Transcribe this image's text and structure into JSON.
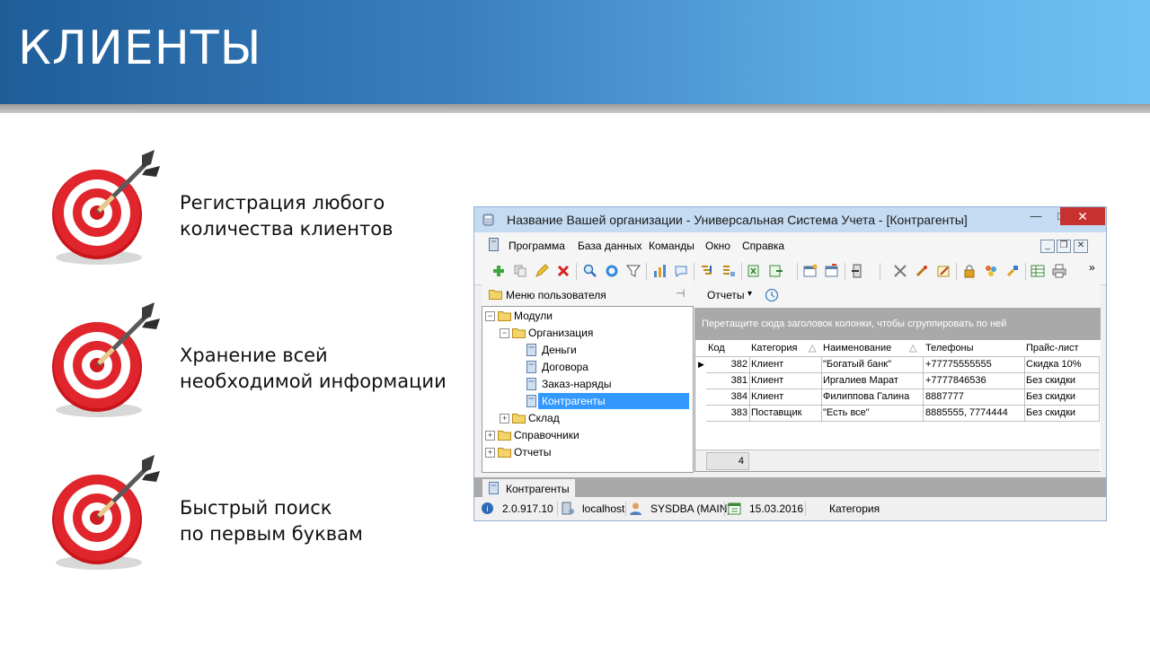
{
  "slide": {
    "title": "КЛИЕНТЫ",
    "bullets": [
      {
        "line1": "Регистрация любого",
        "line2": "количества клиентов"
      },
      {
        "line1": "Хранение всей",
        "line2": "необходимой информации"
      },
      {
        "line1": "Быстрый поиск",
        "line2": "по первым буквам"
      }
    ]
  },
  "window": {
    "title": "Название Вашей организации - Универсальная Система Учета - [Контрагенты]",
    "controls": {
      "minimize": "—",
      "maximize": "□",
      "close": "✕"
    },
    "menu": [
      "Программа",
      "База данных",
      "Команды",
      "Окно",
      "Справка"
    ],
    "mdi": {
      "minimize": "_",
      "restore": "❐",
      "close": "✕"
    },
    "more": "»",
    "left_panel": {
      "header": "Меню пользователя",
      "pin": "⊣",
      "tree": [
        {
          "label": "Модули",
          "expander": "−",
          "kind": "folder"
        },
        {
          "label": "Организация",
          "expander": "−",
          "kind": "folder"
        },
        {
          "label": "Деньги",
          "kind": "doc"
        },
        {
          "label": "Договора",
          "kind": "doc"
        },
        {
          "label": "Заказ-наряды",
          "kind": "doc"
        },
        {
          "label": "Контрагенты",
          "kind": "doc",
          "selected": true
        },
        {
          "label": "Склад",
          "expander": "+",
          "kind": "folder"
        },
        {
          "label": "Справочники",
          "expander": "+",
          "kind": "folder"
        },
        {
          "label": "Отчеты",
          "expander": "+",
          "kind": "folder"
        }
      ]
    },
    "right_panel": {
      "reports_label": "Отчеты",
      "reports_arrow": "▾",
      "group_hint": "Перетащите сюда заголовок колонки, чтобы сгруппировать по ней",
      "columns": [
        "Код",
        "Категория",
        "Наименование",
        "Телефоны",
        "Прайс-лист"
      ],
      "sort_mark": "△",
      "rows": [
        {
          "code": "382",
          "category": "Клиент",
          "name": "\"Богатый банк\"",
          "phones": "+77775555555",
          "price": "Скидка 10%"
        },
        {
          "code": "381",
          "category": "Клиент",
          "name": "Иргалиев Марат",
          "phones": "+7777846536",
          "price": "Без скидки"
        },
        {
          "code": "384",
          "category": "Клиент",
          "name": "Филиппова Галина",
          "phones": "8887777",
          "price": "Без скидки"
        },
        {
          "code": "383",
          "category": "Поставщик",
          "name": "\"Есть все\"",
          "phones": "8885555, 7774444",
          "price": "Без скидки"
        }
      ],
      "row_indicator": "▶",
      "footer_count": "4"
    },
    "tab": "Контрагенты",
    "status": {
      "version": "2.0.917.10",
      "host": "localhost",
      "user": "SYSDBA (MAIN)",
      "date": "15.03.2016",
      "field": "Категория"
    }
  }
}
